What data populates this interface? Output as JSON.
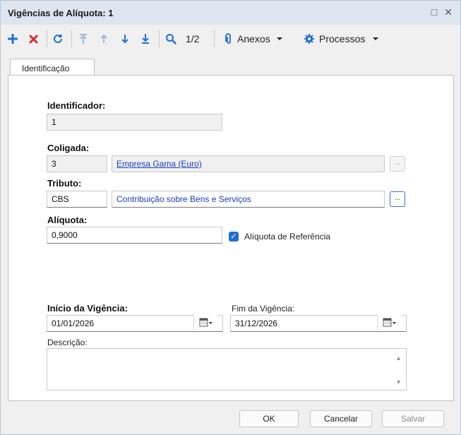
{
  "window": {
    "title": "Vigências de Alíquota: 1",
    "maximize_glyph": "□",
    "close_glyph": "✕"
  },
  "toolbar": {
    "page_indicator": "1/2",
    "attachments_label": "Anexos",
    "processes_label": "Processos",
    "icons": [
      "plus-icon",
      "delete-icon",
      "refresh-icon",
      "first-icon",
      "up-icon",
      "down-icon",
      "last-icon",
      "search-icon",
      "paperclip-icon",
      "gear-icon"
    ]
  },
  "tabs": [
    {
      "label": "Identificação"
    }
  ],
  "form": {
    "identificador_label": "Identificador:",
    "identificador_value": "1",
    "coligada_label": "Coligada:",
    "coligada_code": "3",
    "coligada_name": "Empresa Gama (Euro)",
    "tributo_label": "Tributo:",
    "tributo_code": "CBS",
    "tributo_name": "Contribuição sobre Bens e Serviços",
    "lookup_label": "...",
    "aliquota_label": "Alíquota:",
    "aliquota_value": "0,9000",
    "aliquota_ref_label": "Alíquota de Referência",
    "aliquota_ref_checked": true,
    "inicio_label": "Início da Vigência:",
    "inicio_value": "01/01/2026",
    "fim_label": "Fim da Vigência:",
    "fim_value": "31/12/2026",
    "descricao_label": "Descrição:",
    "descricao_value": ""
  },
  "footer": {
    "ok_label": "OK",
    "cancel_label": "Cancelar",
    "save_label": "Salvar"
  },
  "colors": {
    "titlebar": "#dde5ef",
    "accent": "#1f6fd1",
    "delete": "#d32f2f",
    "link": "#1a3bcc"
  }
}
